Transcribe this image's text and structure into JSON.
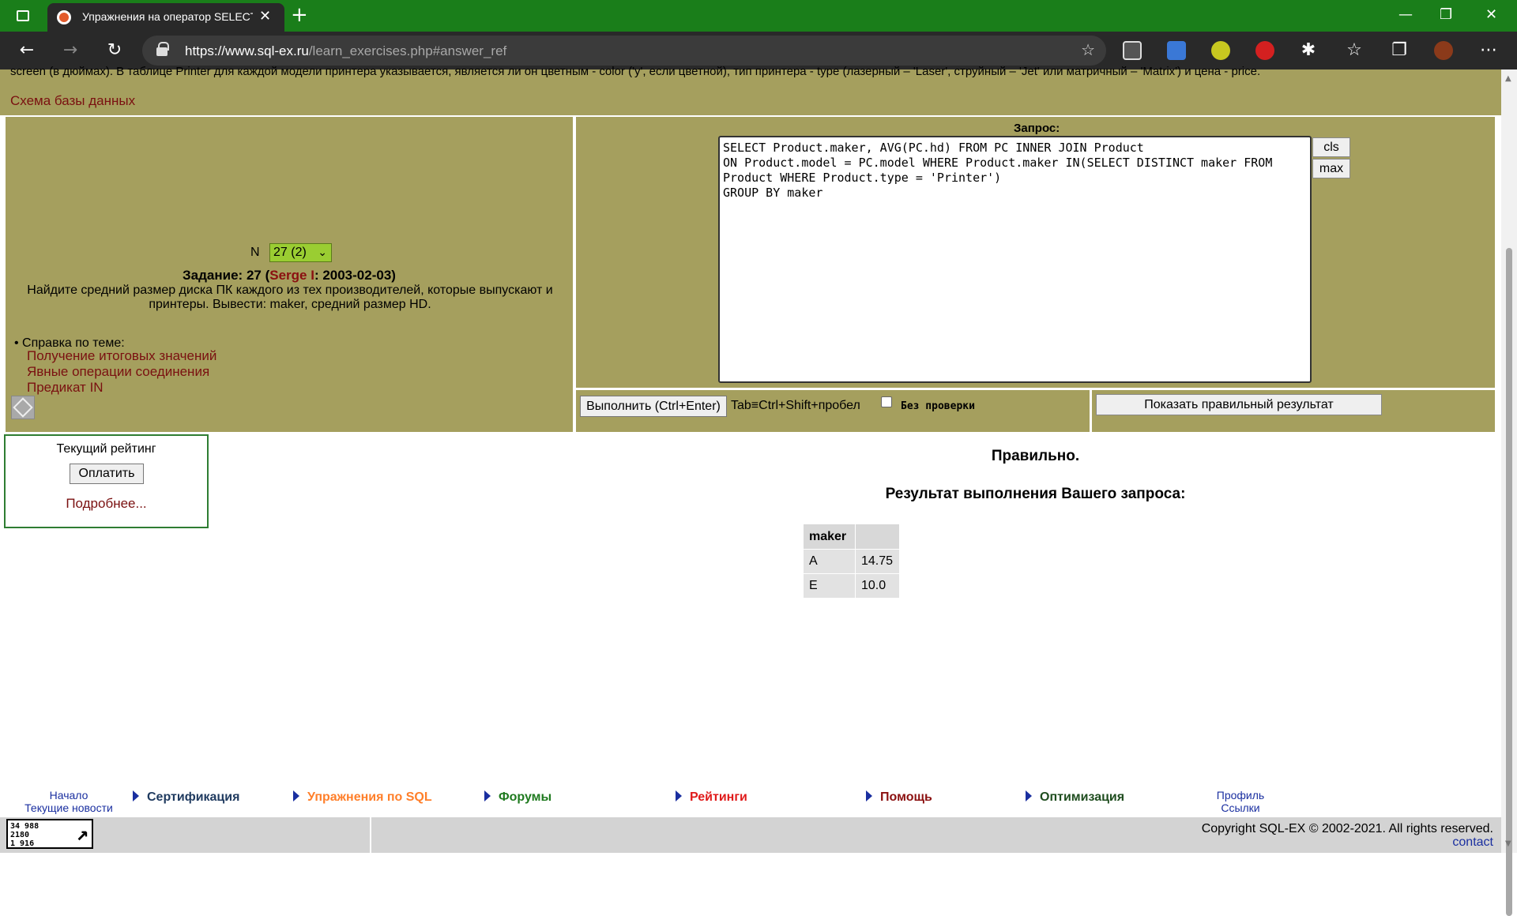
{
  "browser": {
    "tab_title": "Упражнения на оператор SELECT",
    "tab_close": "✕",
    "new_tab": "+",
    "url_domain": "https://www.sql-ex.ru",
    "url_path": "/learn_exercises.php#answer_ref",
    "window_controls": [
      "—",
      "❐",
      "✕"
    ]
  },
  "page": {
    "description": "screen (в дюймах). В таблице Printer для каждой модели принтера указывается, является ли он цветным - color ('y', если цветной), тип принтера - type (лазерный – 'Laser', струйный – 'Jet' или матричный – 'Matrix') и цена - price.",
    "schema_link": "Схема базы данных",
    "selector": {
      "label": "N",
      "value": "27 (2)"
    },
    "task": {
      "prefix": "Задание: 27 (",
      "author": "Serge I",
      "suffix": ": 2003-02-03)",
      "text": "Найдите средний размер диска ПК каждого из тех производителей, которые выпускают и принтеры. Вывести: maker, средний размер HD."
    },
    "help": {
      "title": "• Справка по теме:",
      "links": [
        "Получение итоговых значений",
        "Явные операции соединения",
        "Предикат IN"
      ]
    },
    "query_label": "Запрос:",
    "query": "SELECT Product.maker, AVG(PC.hd) FROM PC INNER JOIN Product\nON Product.model = PC.model WHERE Product.maker IN(SELECT DISTINCT maker FROM\nProduct WHERE Product.type = 'Printer')\nGROUP BY maker",
    "cls_button": "cls",
    "max_button": "max",
    "run_button": "Выполнить (Ctrl+Enter)",
    "tab_hint": "Tab≡Ctrl+Shift+пробел",
    "no_check_label": "Без проверки",
    "show_result_button": "Показать правильный результат",
    "rating": {
      "title": "Текущий рейтинг",
      "pay_button": "Оплатить",
      "more_link": "Подробнее..."
    },
    "status": "Правильно.",
    "result_title": "Результат выполнения Вашего запроса:",
    "result_table": {
      "headers": [
        "maker",
        ""
      ],
      "rows": [
        [
          "A",
          "14.75"
        ],
        [
          "E",
          "10.0"
        ]
      ]
    }
  },
  "footer": {
    "left_links": [
      "Начало",
      "Текущие новости"
    ],
    "nav": [
      {
        "label": "Сертификация",
        "color": "#1f3a5f"
      },
      {
        "label": "Упражнения по SQL",
        "color": "#ff7f2a"
      },
      {
        "label": "Форумы",
        "color": "#1f7a1f"
      },
      {
        "label": "Рейтинги",
        "color": "#e01b1b"
      },
      {
        "label": "Помощь",
        "color": "#8b1010"
      },
      {
        "label": "Оптимизация",
        "color": "#1f4d1f"
      }
    ],
    "right_links": [
      "Профиль",
      "Ссылки"
    ],
    "counter": [
      "34 988",
      "2180",
      "1 916"
    ],
    "copyright": "Copyright SQL-EX © 2002-2021. All rights reserved.",
    "contact": "contact"
  }
}
